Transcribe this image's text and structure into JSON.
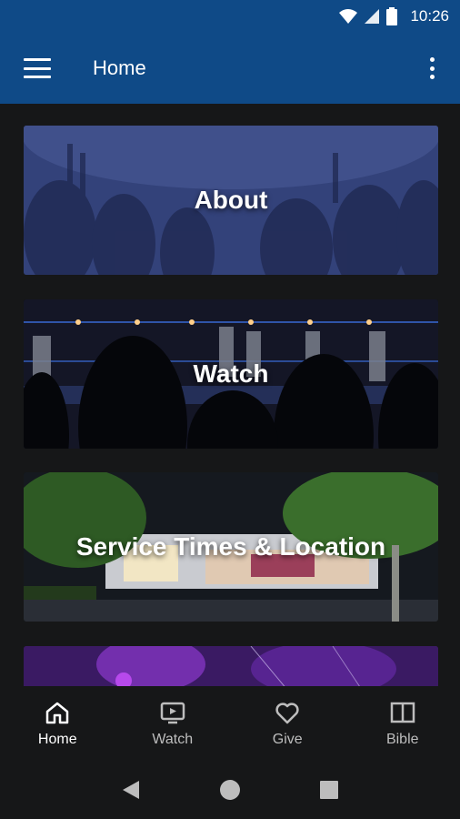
{
  "status_bar": {
    "time": "10:26",
    "icons": [
      "wifi-icon",
      "signal-icon",
      "battery-icon"
    ]
  },
  "app_bar": {
    "title": "Home",
    "menu_icon": "hamburger-icon",
    "overflow_icon": "more-vert-icon"
  },
  "cards": [
    {
      "label": "About",
      "image": "worship crowd with raised hands, blue tint"
    },
    {
      "label": "Watch",
      "image": "band on stage with audience silhouettes"
    },
    {
      "label": "Service Times & Location",
      "image": "church building at night with trees"
    },
    {
      "label": "",
      "image": "purple stage lights"
    }
  ],
  "bottom_nav": {
    "items": [
      {
        "label": "Home",
        "icon": "home-icon",
        "active": true
      },
      {
        "label": "Watch",
        "icon": "tv-icon",
        "active": false
      },
      {
        "label": "Give",
        "icon": "heart-icon",
        "active": false
      },
      {
        "label": "Bible",
        "icon": "book-icon",
        "active": false
      }
    ]
  },
  "system_nav": {
    "icons": [
      "back-icon",
      "home-circle-icon",
      "recents-icon"
    ]
  },
  "colors": {
    "primary": "#0f4a87",
    "background": "#161718",
    "nav_active": "#ffffff",
    "nav_inactive": "#bdbdbd"
  }
}
